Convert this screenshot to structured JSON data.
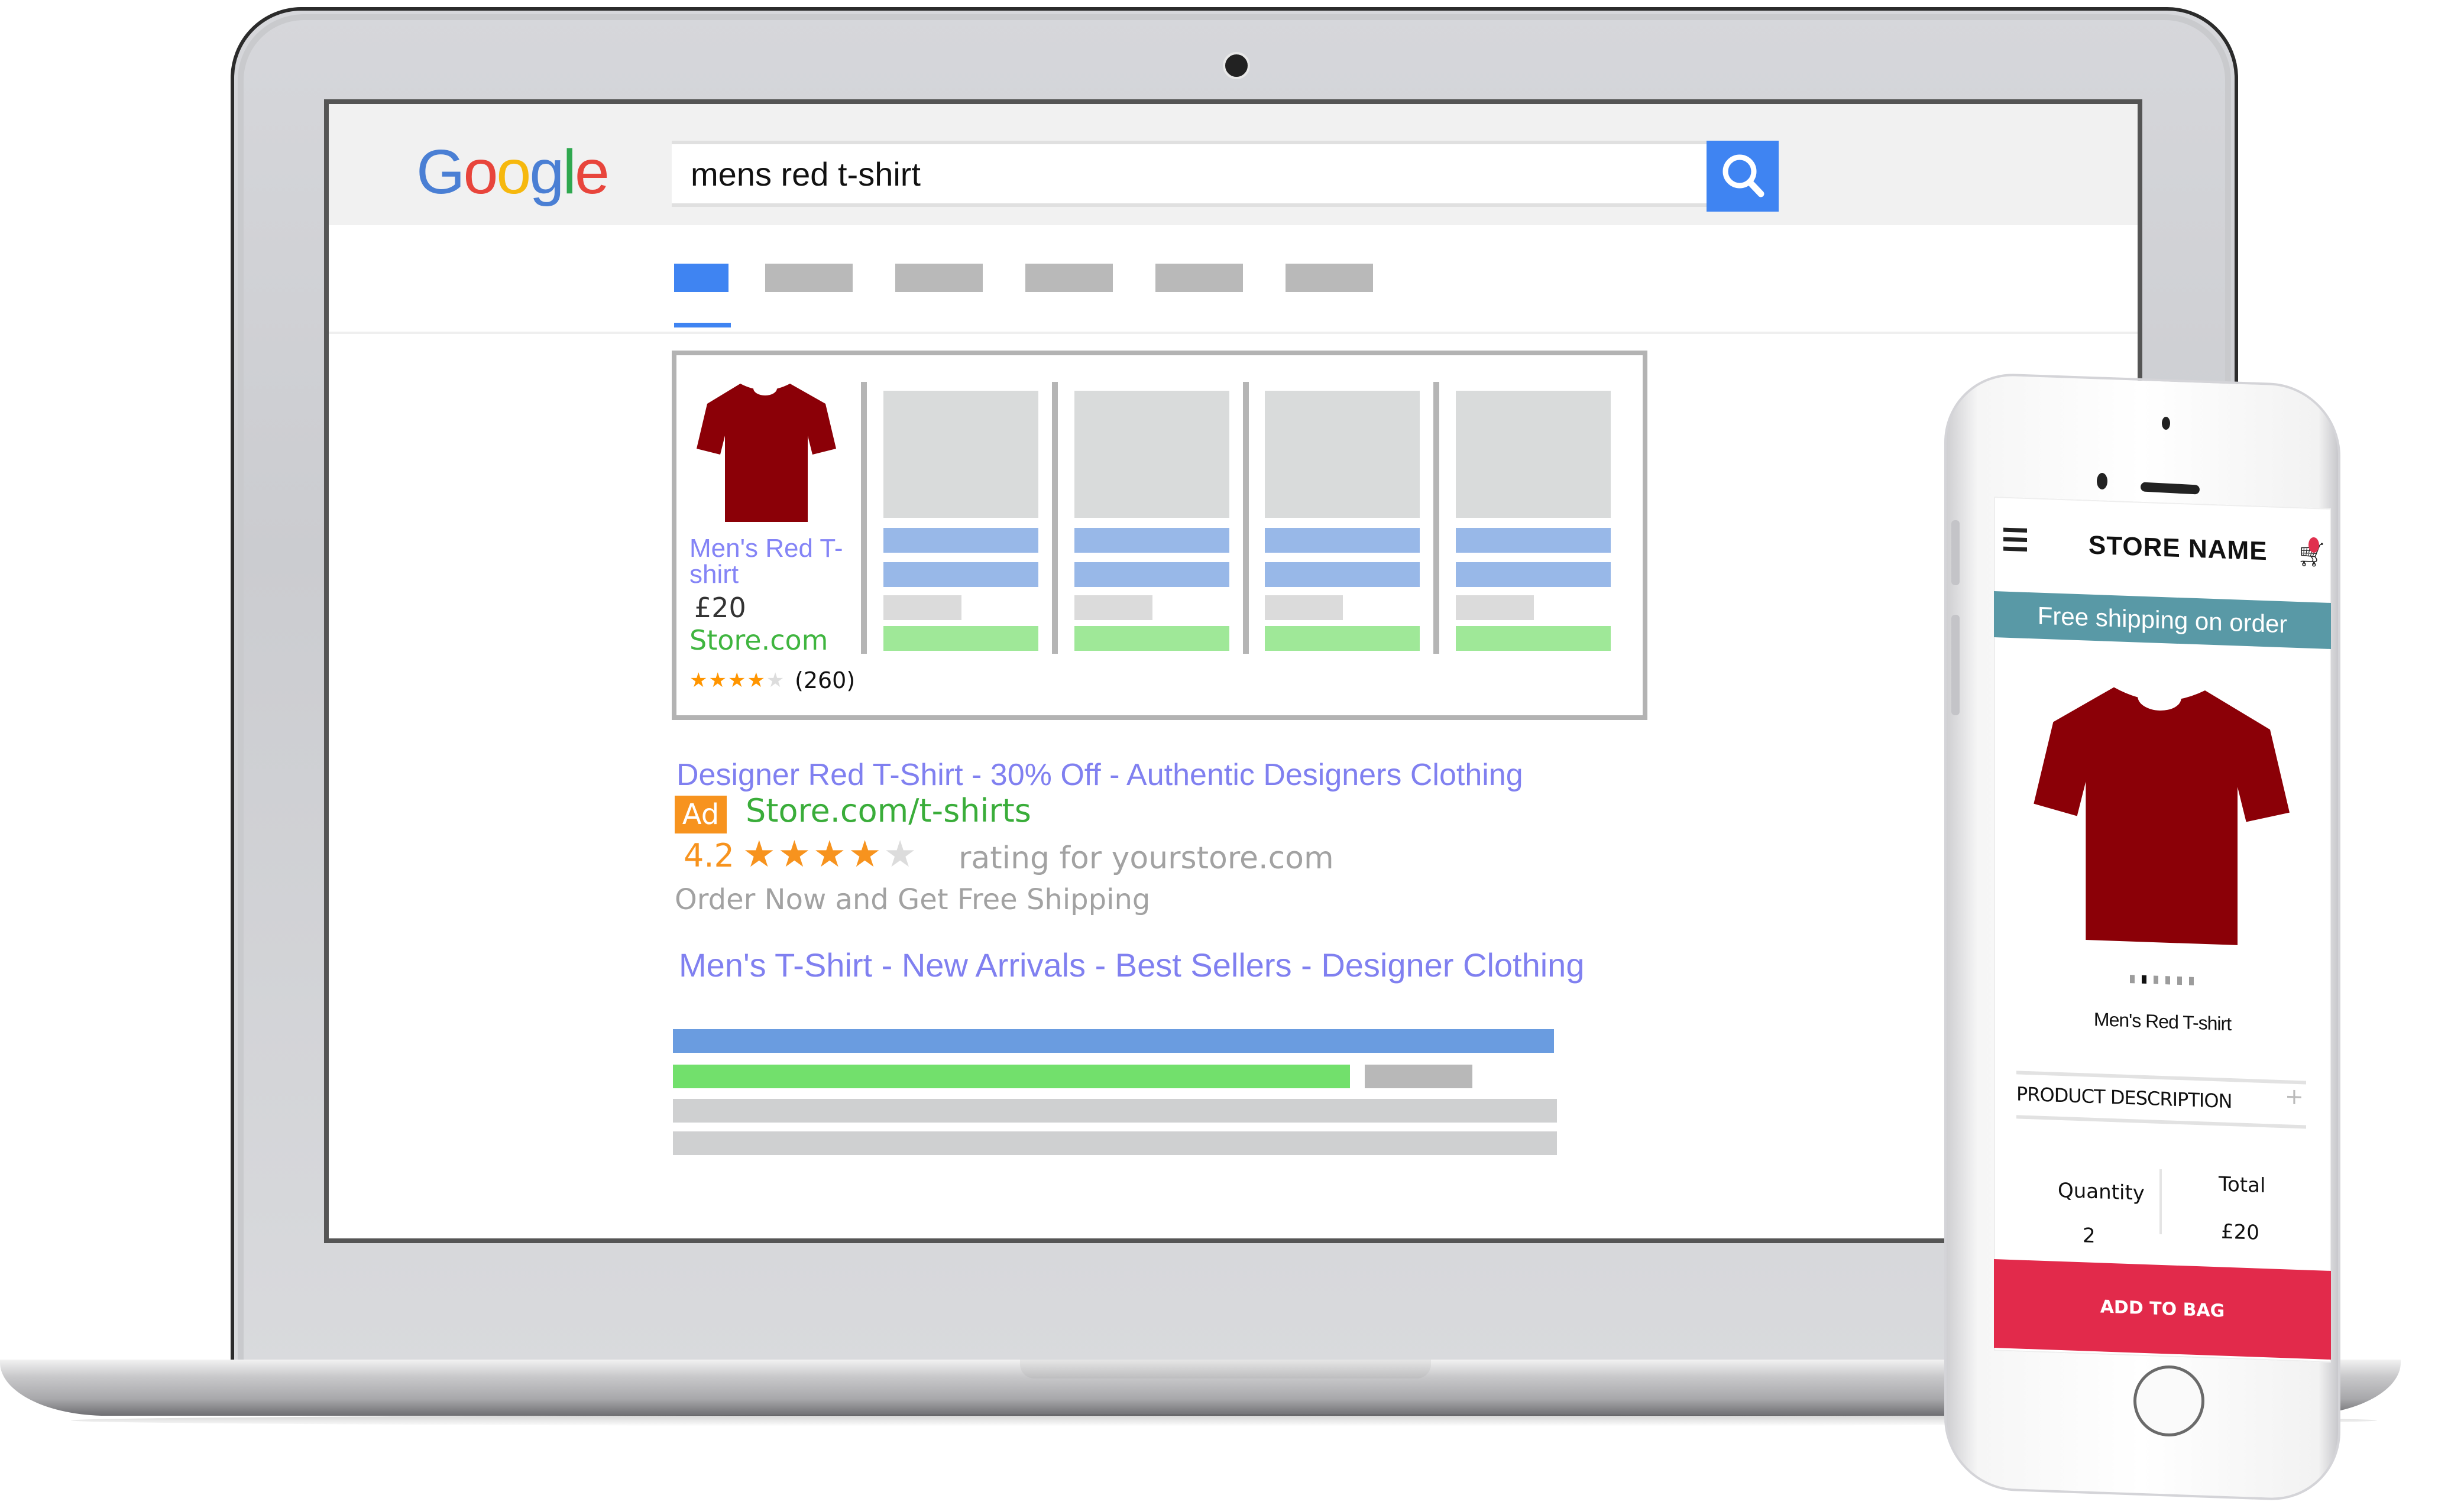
{
  "laptop": {
    "browser": {
      "logo": {
        "letters": [
          "G",
          "o",
          "o",
          "g",
          "l",
          "e"
        ],
        "colors": [
          "#4a7fd4",
          "#e8453c",
          "#f6b80e",
          "#4a7fd4",
          "#2fa84f",
          "#e8453c"
        ]
      },
      "search": {
        "query": "mens red t-shirt",
        "button_icon": "search-icon"
      },
      "tabs": {
        "count": 6,
        "active_index": 0,
        "active_color": "#3f84f2",
        "inactive_color": "#b9b9b9"
      },
      "shopping_carousel": {
        "featured": {
          "title": "Men's Red T-shirt",
          "price": "£20",
          "store": "Store.com",
          "rating_stars": 4,
          "rating_max": 5,
          "review_count": "(260)"
        },
        "placeholder_cards": 4
      },
      "ad_result": {
        "title": "Designer Red T-Shirt - 30% Off - Authentic Designers Clothing",
        "badge": "Ad",
        "url": "Store.com/t-shirts",
        "rating": "4.2",
        "rating_stars": 4,
        "rating_max": 5,
        "rating_text": "rating for yourstore.com",
        "description": "Order Now and Get Free Shipping",
        "sitelinks": "Men's T-Shirt - New Arrivals - Best Sellers - Designer Clothing"
      },
      "colors": {
        "link": "#8080f0",
        "url_green": "#3aad3a",
        "badge_orange": "#f7931e",
        "grey_text": "#a2a2a2"
      }
    }
  },
  "phone": {
    "store_name": "STORE NAME",
    "banner": "Free shipping on order",
    "banner_color": "#5999a6",
    "image_dots": {
      "count": 6,
      "active_index": 1
    },
    "product_name": "Men's Red T-shirt",
    "description_label": "PRODUCT DESCRIPTION",
    "description_toggle": "+",
    "quantity_label": "Quantity",
    "quantity_value": "2",
    "total_label": "Total",
    "total_value": "£20",
    "add_button": "ADD TO BAG",
    "add_button_color": "#e22a4b",
    "cart_icon": "cart-icon",
    "menu_icon": "hamburger-menu-icon"
  }
}
